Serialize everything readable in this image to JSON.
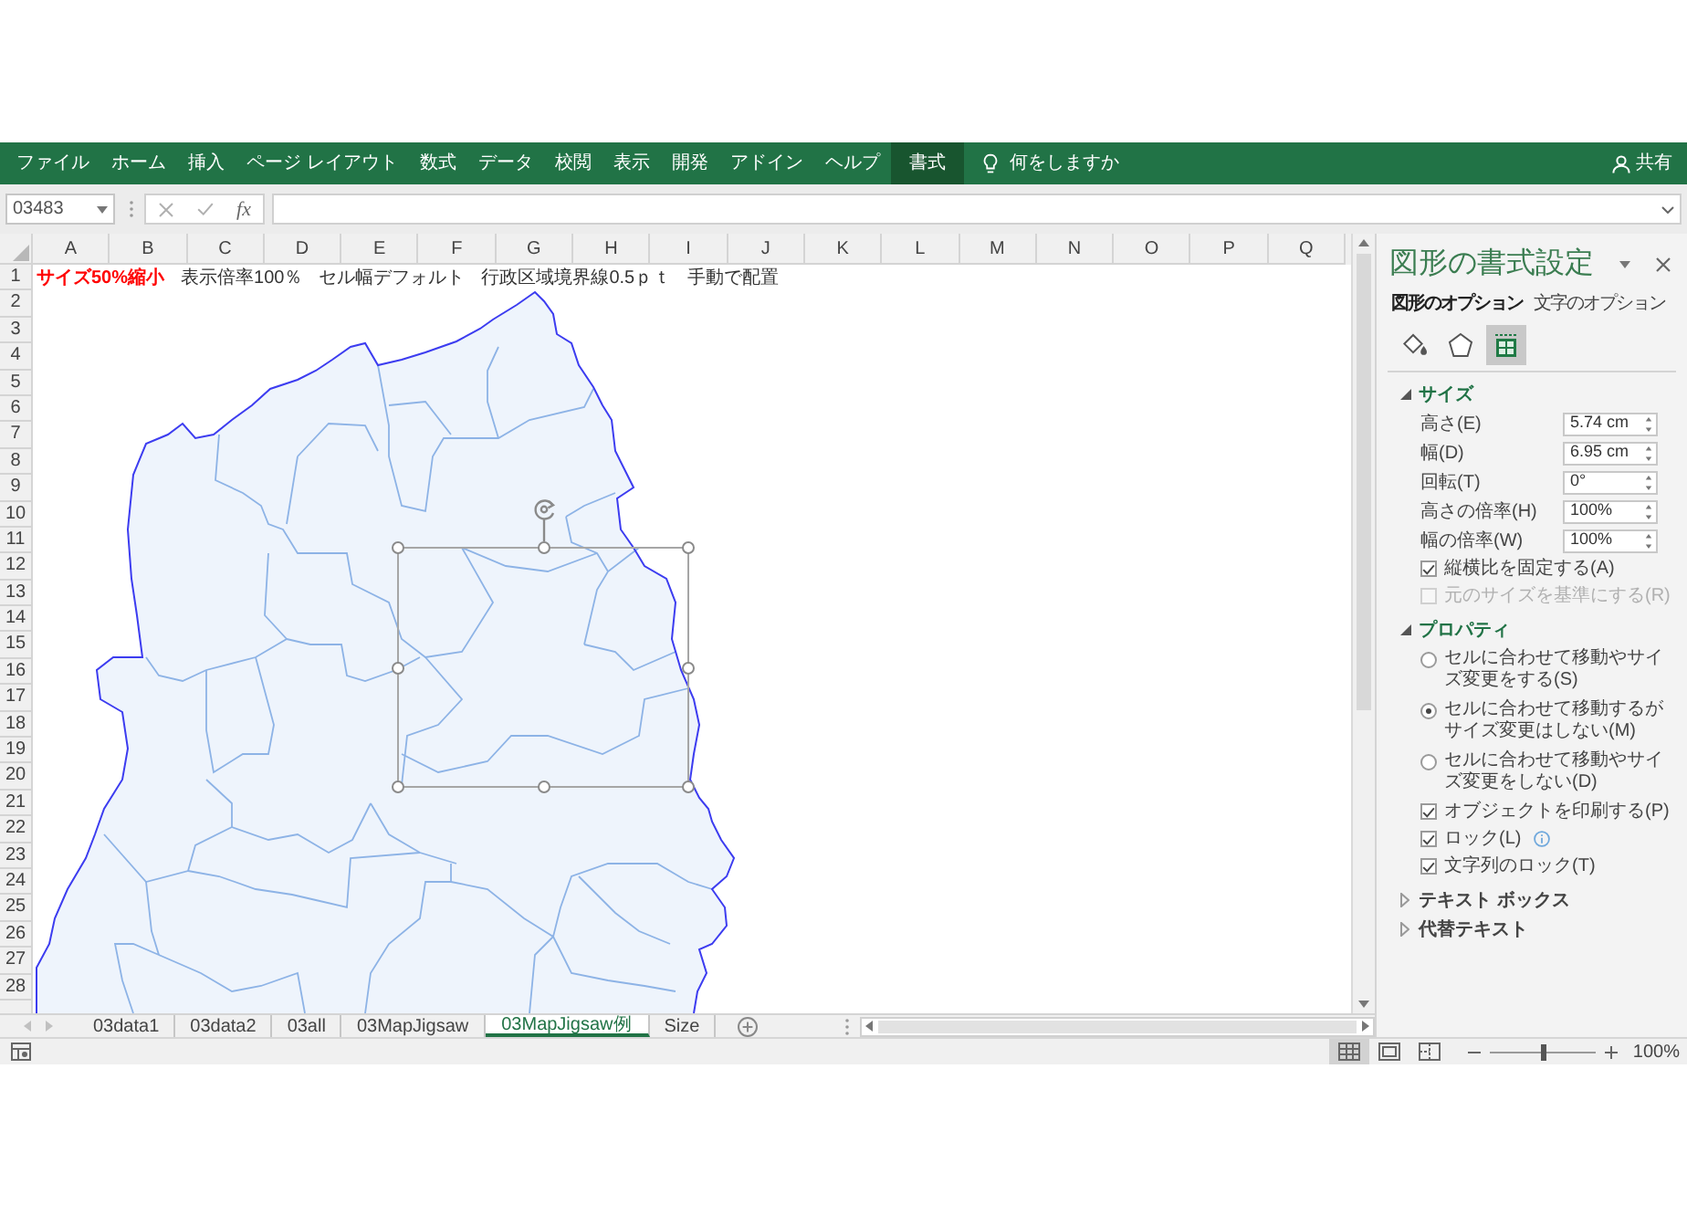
{
  "ribbon": {
    "tabs": [
      {
        "label": "ファイル",
        "selected": false
      },
      {
        "label": "ホーム",
        "selected": false
      },
      {
        "label": "挿入",
        "selected": false
      },
      {
        "label": "ページ レイアウト",
        "selected": false
      },
      {
        "label": "数式",
        "selected": false
      },
      {
        "label": "データ",
        "selected": false
      },
      {
        "label": "校閲",
        "selected": false
      },
      {
        "label": "表示",
        "selected": false
      },
      {
        "label": "開発",
        "selected": false
      },
      {
        "label": "アドイン",
        "selected": false
      },
      {
        "label": "ヘルプ",
        "selected": false
      },
      {
        "label": "書式",
        "selected": true
      }
    ],
    "tell_me": "何をしますか",
    "share": "共有"
  },
  "formula_bar": {
    "name_box": "03483",
    "function_button": "fx"
  },
  "sheet": {
    "columns": [
      "A",
      "B",
      "C",
      "D",
      "E",
      "F",
      "G",
      "H",
      "I",
      "J",
      "K",
      "L",
      "M",
      "N",
      "O",
      "P",
      "Q"
    ],
    "rows": [
      "1",
      "2",
      "3",
      "4",
      "5",
      "6",
      "7",
      "8",
      "9",
      "10",
      "11",
      "12",
      "13",
      "14",
      "15",
      "16",
      "17",
      "18",
      "19",
      "20",
      "21",
      "22",
      "23",
      "24",
      "25",
      "26",
      "27",
      "28"
    ],
    "row_1_texts": [
      {
        "text": "サイズ50%縮小",
        "emphasis": true
      },
      {
        "text": "表示倍率100％",
        "emphasis": false
      },
      {
        "text": "セル幅デフォルト",
        "emphasis": false
      },
      {
        "text": "行政区域境界線0.5ｐｔ",
        "emphasis": false
      },
      {
        "text": "手動で配置",
        "emphasis": false
      }
    ]
  },
  "format_pane": {
    "title": "図形の書式設定",
    "tabs": [
      {
        "label": "図形のオプション",
        "selected": true
      },
      {
        "label": "文字のオプション",
        "selected": false
      }
    ],
    "icon_tabs": [
      {
        "kind": "fill",
        "selected": false
      },
      {
        "kind": "shape",
        "selected": false
      },
      {
        "kind": "size",
        "selected": true
      }
    ],
    "sections": [
      {
        "title": "サイズ",
        "expanded": true,
        "items": [
          {
            "kind": "spin",
            "label": "高さ(E)",
            "value": "5.74 cm"
          },
          {
            "kind": "spin",
            "label": "幅(D)",
            "value": "6.95 cm"
          },
          {
            "kind": "spin",
            "label": "回転(T)",
            "value": "0°"
          },
          {
            "kind": "spin",
            "label": "高さの倍率(H)",
            "value": "100%"
          },
          {
            "kind": "spin",
            "label": "幅の倍率(W)",
            "value": "100%"
          },
          {
            "kind": "checkbox",
            "label": "縦横比を固定する(A)",
            "checked": true,
            "disabled": false,
            "info": false
          },
          {
            "kind": "checkbox",
            "label": "元のサイズを基準にする(R)",
            "checked": false,
            "disabled": true,
            "info": false
          }
        ]
      },
      {
        "title": "プロパティ",
        "expanded": true,
        "items": [
          {
            "kind": "radio",
            "label": "セルに合わせて移動やサイズ変更をする(S)",
            "selected": false
          },
          {
            "kind": "radio",
            "label": "セルに合わせて移動するがサイズ変更はしない(M)",
            "selected": true
          },
          {
            "kind": "radio",
            "label": "セルに合わせて移動やサイズ変更をしない(D)",
            "selected": false
          },
          {
            "kind": "checkbox",
            "label": "オブジェクトを印刷する(P)",
            "checked": true,
            "disabled": false,
            "info": false
          },
          {
            "kind": "checkbox",
            "label": "ロック(L)",
            "checked": true,
            "disabled": false,
            "info": true
          },
          {
            "kind": "checkbox",
            "label": "文字列のロック(T)",
            "checked": true,
            "disabled": false,
            "info": false
          }
        ]
      },
      {
        "title": "テキスト ボックス",
        "expanded": false
      },
      {
        "title": "代替テキスト",
        "expanded": false
      }
    ]
  },
  "sheet_tabs": [
    {
      "label": "03data1",
      "selected": false
    },
    {
      "label": "03data2",
      "selected": false
    },
    {
      "label": "03all",
      "selected": false
    },
    {
      "label": "03MapJigsaw",
      "selected": false
    },
    {
      "label": "03MapJigsaw例",
      "selected": true
    },
    {
      "label": "Size",
      "selected": false
    }
  ],
  "status_bar": {
    "views": [
      {
        "kind": "normal",
        "selected": true
      },
      {
        "kind": "page_layout",
        "selected": false
      },
      {
        "kind": "page_break",
        "selected": false
      }
    ],
    "zoom_slider": {
      "level": 0.5
    },
    "zoom": "100%"
  }
}
